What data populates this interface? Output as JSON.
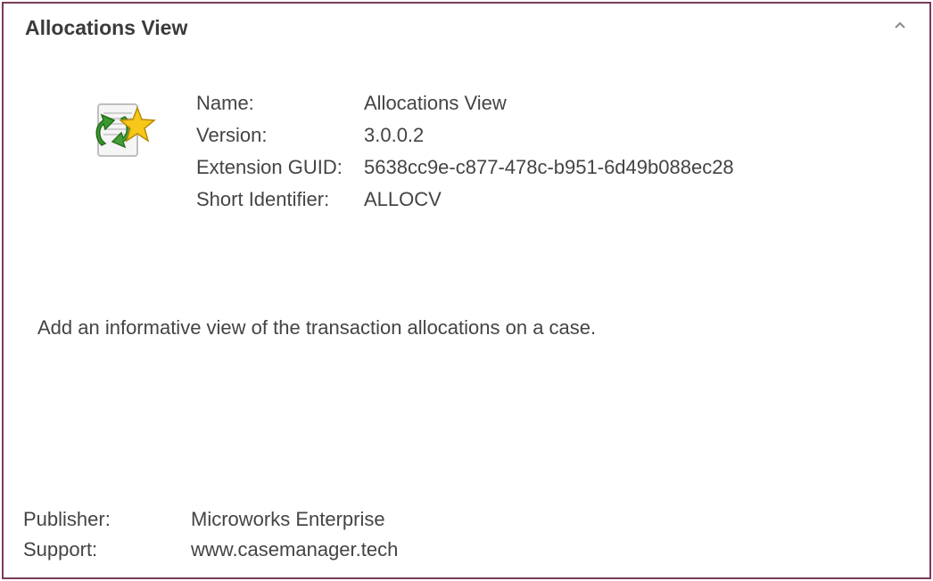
{
  "panel": {
    "title": "Allocations View"
  },
  "info": {
    "name_label": "Name:",
    "name_value": "Allocations View",
    "version_label": "Version:",
    "version_value": "3.0.0.2",
    "guid_label": "Extension GUID:",
    "guid_value": "5638cc9e-c877-478c-b951-6d49b088ec28",
    "shortid_label": "Short Identifier:",
    "shortid_value": "ALLOCV"
  },
  "description": "Add an informative view of the transaction allocations on a case.",
  "footer": {
    "publisher_label": "Publisher:",
    "publisher_value": "Microworks Enterprise",
    "support_label": "Support:",
    "support_value": "www.casemanager.tech"
  }
}
